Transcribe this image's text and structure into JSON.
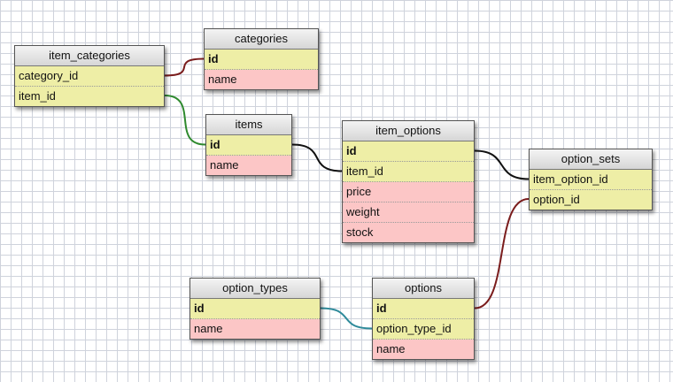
{
  "colors": {
    "key_row": "#eeeea6",
    "plain_row": "#fcc6c6",
    "link_red": "#7a1c1c",
    "link_green": "#2f8a2f",
    "link_black": "#111111",
    "link_teal": "#2e8a9a"
  },
  "tables": {
    "item_categories": {
      "name": "item_categories",
      "fields": [
        {
          "name": "category_id",
          "kind": "key"
        },
        {
          "name": "item_id",
          "kind": "key"
        }
      ]
    },
    "categories": {
      "name": "categories",
      "fields": [
        {
          "name": "id",
          "kind": "pk"
        },
        {
          "name": "name",
          "kind": "plain"
        }
      ]
    },
    "items": {
      "name": "items",
      "fields": [
        {
          "name": "id",
          "kind": "pk"
        },
        {
          "name": "name",
          "kind": "plain"
        }
      ]
    },
    "item_options": {
      "name": "item_options",
      "fields": [
        {
          "name": "id",
          "kind": "pk"
        },
        {
          "name": "item_id",
          "kind": "key"
        },
        {
          "name": "price",
          "kind": "plain"
        },
        {
          "name": "weight",
          "kind": "plain"
        },
        {
          "name": "stock",
          "kind": "plain"
        }
      ]
    },
    "option_sets": {
      "name": "option_sets",
      "fields": [
        {
          "name": "item_option_id",
          "kind": "key"
        },
        {
          "name": "option_id",
          "kind": "key"
        }
      ]
    },
    "option_types": {
      "name": "option_types",
      "fields": [
        {
          "name": "id",
          "kind": "pk"
        },
        {
          "name": "name",
          "kind": "plain"
        }
      ]
    },
    "options": {
      "name": "options",
      "fields": [
        {
          "name": "id",
          "kind": "pk"
        },
        {
          "name": "option_type_id",
          "kind": "key"
        },
        {
          "name": "name",
          "kind": "plain"
        }
      ]
    }
  },
  "relations": [
    {
      "from": "item_categories.category_id",
      "to": "categories.id",
      "color": "#7a1c1c"
    },
    {
      "from": "item_categories.item_id",
      "to": "items.id",
      "color": "#2f8a2f"
    },
    {
      "from": "items.id",
      "to": "item_options.item_id",
      "color": "#111111"
    },
    {
      "from": "item_options.id",
      "to": "option_sets.item_option_id",
      "color": "#111111"
    },
    {
      "from": "option_sets.option_id",
      "to": "options.id",
      "color": "#7a1c1c"
    },
    {
      "from": "option_types.id",
      "to": "options.option_type_id",
      "color": "#2e8a9a"
    }
  ]
}
